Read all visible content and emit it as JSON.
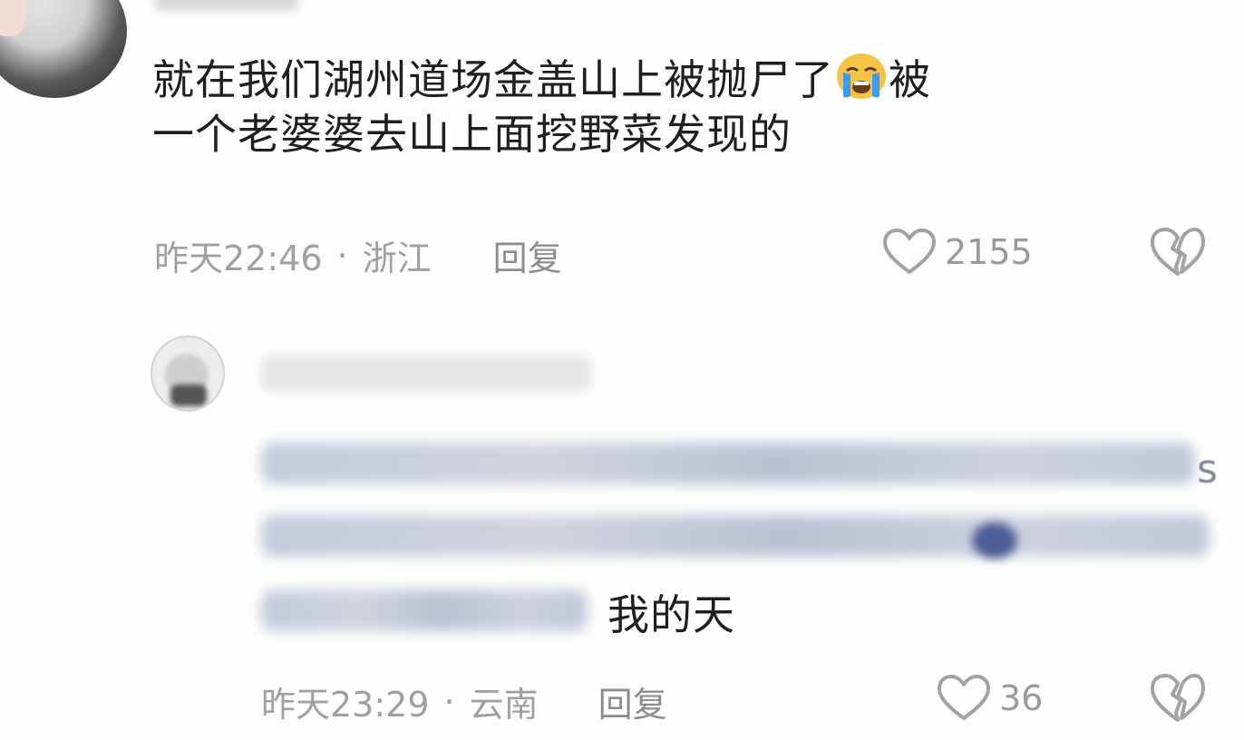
{
  "comment": {
    "text_line1": "就在我们湖州道场金盖山上被抛尸了",
    "emoji": "loudly-crying-face-emoji",
    "text_line1_tail": "被",
    "text_line2": "一个老婆婆去山上面挖野菜发现的",
    "time": "昨天22:46",
    "separator": "·",
    "location": "浙江",
    "reply_label": "回复",
    "likes": "2155",
    "like_icon": "heart-outline-icon",
    "dislike_icon": "broken-heart-icon"
  },
  "reply": {
    "partial_letter": "s",
    "visible_text": "我的天",
    "time": "昨天23:29",
    "separator": "·",
    "location": "云南",
    "reply_label": "回复",
    "likes": "36",
    "like_icon": "heart-outline-icon",
    "dislike_icon": "broken-heart-icon"
  },
  "colors": {
    "background": "#fefefe",
    "text": "#1f1f1f",
    "meta": "#a0a0a0",
    "emoji_face": "#f6c445",
    "emoji_tears": "#3c9bf0"
  }
}
